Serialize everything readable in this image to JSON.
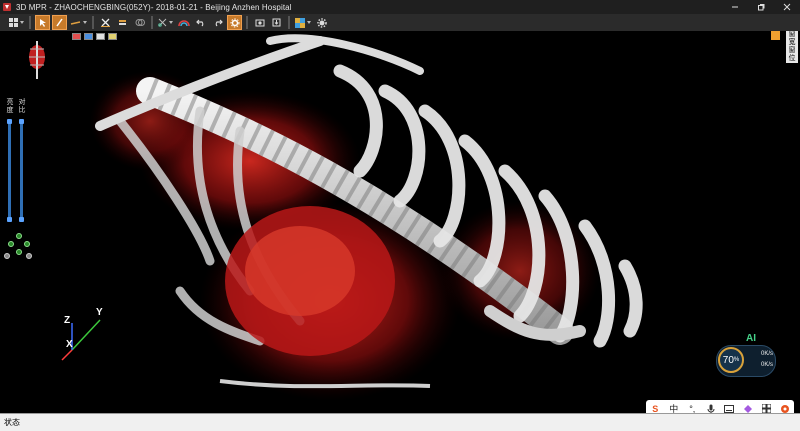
{
  "window": {
    "title": "3D MPR - ZHAOCHENGBING(052Y)- 2018-01-21 - Beijing Anzhen Hospital",
    "controls": [
      "minimize-icon",
      "restore-icon",
      "close-icon"
    ]
  },
  "toolbar": {
    "tools": [
      {
        "icon": "layout-grid-icon",
        "has_menu": true,
        "active": false
      },
      {
        "icon": "select-pointer-icon",
        "has_menu": false,
        "active": true
      },
      {
        "icon": "pen-tool-icon",
        "has_menu": false,
        "active": true
      },
      {
        "icon": "line-measure-icon",
        "has_menu": true,
        "active": false
      },
      {
        "icon": "delete-annotation-icon",
        "has_menu": false,
        "active": false
      },
      {
        "icon": "text-annotation-icon",
        "has_menu": false,
        "active": false
      },
      {
        "icon": "eraser-icon",
        "has_menu": false,
        "active": false
      },
      {
        "icon": "scissors-cut-icon",
        "has_menu": true,
        "active": false
      },
      {
        "icon": "color-rainbow-icon",
        "has_menu": false,
        "active": false
      },
      {
        "icon": "undo-icon",
        "has_menu": false,
        "active": false
      },
      {
        "icon": "redo-icon",
        "has_menu": false,
        "active": false
      },
      {
        "icon": "settings-gear-icon",
        "has_menu": false,
        "active": true
      },
      {
        "icon": "screenshot-camera-icon",
        "has_menu": false,
        "active": false
      },
      {
        "icon": "export-icon",
        "has_menu": false,
        "active": false
      },
      {
        "icon": "color-palette-icon",
        "has_menu": true,
        "active": false
      },
      {
        "icon": "preferences-icon",
        "has_menu": false,
        "active": false
      }
    ]
  },
  "left_panel": {
    "slider_brightness_label": "亮度",
    "slider_contrast_label": "对比",
    "swatch_colors": [
      "#e35050",
      "#4a8fe0",
      "#e0e0e0",
      "#e0d070"
    ]
  },
  "right_tab": {
    "label": "窗宽窗位"
  },
  "axes": {
    "x": "X",
    "y": "Y",
    "z": "Z"
  },
  "net_widget": {
    "percent": "70",
    "percent_unit": "%",
    "up_speed": "0K/s",
    "down_speed": "0K/s",
    "ai_label": "AI"
  },
  "ime_bar": {
    "mode_label": "中",
    "items": [
      "sogou-logo-icon",
      "punctuation-icon",
      "microphone-icon",
      "keyboard-icon",
      "skin-icon",
      "toolbox-grid-icon",
      "mascot-icon"
    ]
  },
  "statusbar": {
    "text": "状态"
  },
  "colors": {
    "accent_active": "#c77a2a",
    "render_red": "#c8201a",
    "bone_white": "#e8e8e8",
    "slider_blue": "#2f6fb5"
  }
}
